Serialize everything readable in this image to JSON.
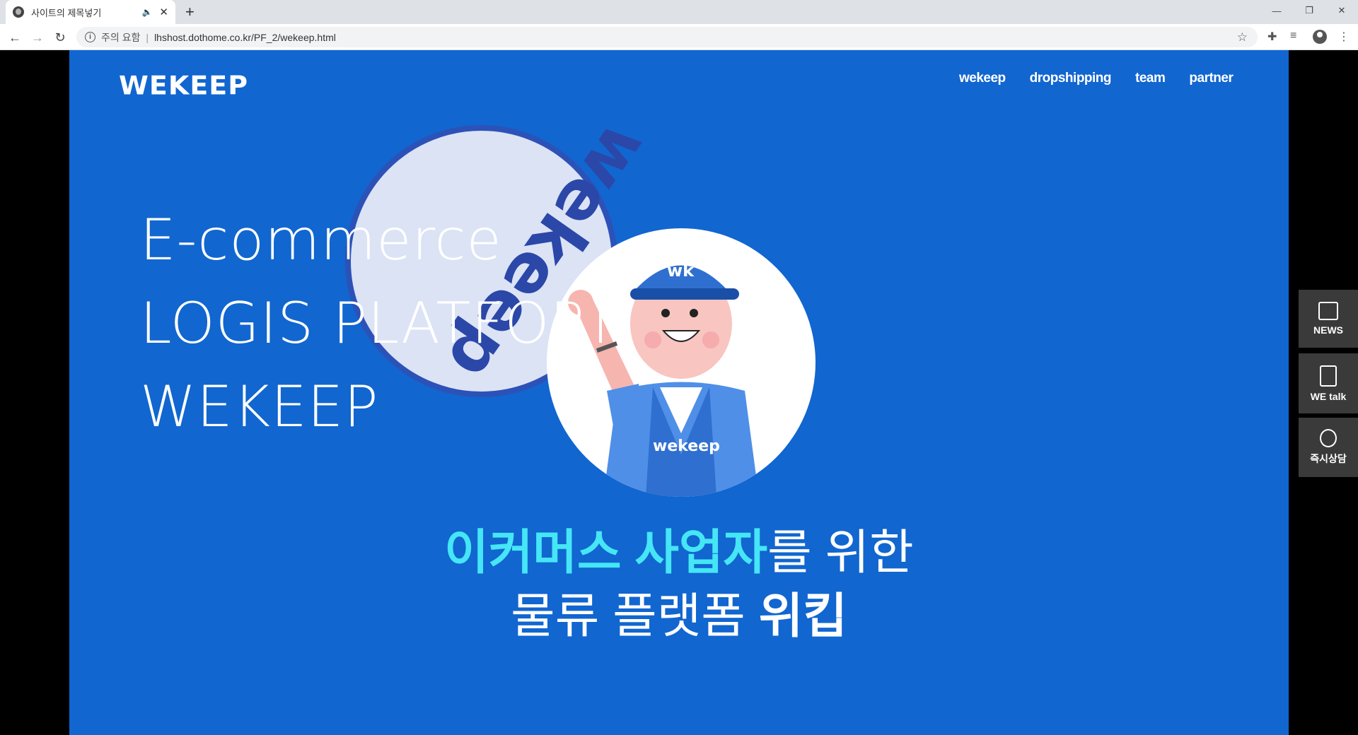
{
  "browser": {
    "tab_title": "사이트의 제목넣기",
    "audio_icon": "speaker-icon",
    "close_label": "✕",
    "new_tab_label": "+",
    "security_label": "주의 요함",
    "url": "lhshost.dothome.co.kr/PF_2/wekeep.html",
    "window_controls": {
      "minimize": "—",
      "restore": "❐",
      "close": "✕"
    }
  },
  "site": {
    "logo": "WEKEEP",
    "nav": [
      "wekeep",
      "dropshipping",
      "team",
      "partner"
    ],
    "headline": [
      "E-commerce",
      "LOGIS PLATFORM",
      "WEKEEP"
    ],
    "disc_text": "wekeep",
    "copy_line1_highlight": "이커머스 사업자",
    "copy_line1_rest": "를 위한",
    "copy_line2_regular": "물류 플랫폼 ",
    "copy_line2_bold": "위킵",
    "side_buttons": [
      "NEWS",
      "WE talk",
      "즉시상담"
    ],
    "colors": {
      "hero_bg": "#1166d0",
      "highlight": "#45e6f5",
      "side_bg": "#3a3a3a"
    }
  }
}
